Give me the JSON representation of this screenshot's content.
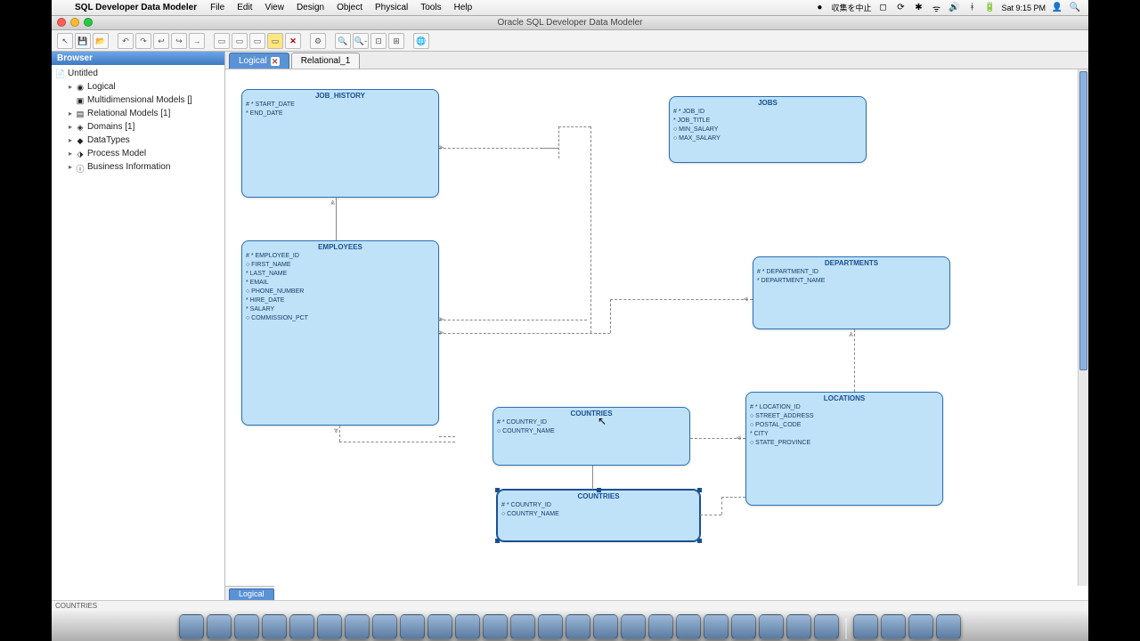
{
  "menubar": {
    "app_name": "SQL Developer Data Modeler",
    "menus": [
      "File",
      "Edit",
      "View",
      "Design",
      "Object",
      "Physical",
      "Tools",
      "Help"
    ],
    "status_text": "収集を中止",
    "clock": "Sat 9:15 PM"
  },
  "window": {
    "title": "Oracle SQL Developer Data Modeler"
  },
  "browser": {
    "header": "Browser",
    "root": "Untitled",
    "items": [
      {
        "label": "Logical",
        "depth": 1,
        "disclose": "▸"
      },
      {
        "label": "Multidimensional Models []",
        "depth": 1,
        "disclose": ""
      },
      {
        "label": "Relational Models [1]",
        "depth": 1,
        "disclose": "▸"
      },
      {
        "label": "Domains [1]",
        "depth": 1,
        "disclose": "▸"
      },
      {
        "label": "DataTypes",
        "depth": 1,
        "disclose": "▸"
      },
      {
        "label": "Process Model",
        "depth": 1,
        "disclose": "▸"
      },
      {
        "label": "Business Information",
        "depth": 1,
        "disclose": "▸"
      }
    ]
  },
  "tabs": {
    "top": [
      {
        "label": "Logical",
        "active": true,
        "closable": true
      },
      {
        "label": "Relational_1",
        "active": false,
        "closable": false
      }
    ],
    "bottom": "Logical"
  },
  "entities": {
    "job_history": {
      "title": "JOB_HISTORY",
      "attrs": [
        "# * START_DATE",
        "* END_DATE"
      ]
    },
    "jobs": {
      "title": "JOBS",
      "attrs": [
        "# * JOB_ID",
        "* JOB_TITLE",
        "○ MIN_SALARY",
        "○ MAX_SALARY"
      ]
    },
    "employees": {
      "title": "EMPLOYEES",
      "attrs": [
        "# * EMPLOYEE_ID",
        "○ FIRST_NAME",
        "* LAST_NAME",
        "* EMAIL",
        "○ PHONE_NUMBER",
        "* HIRE_DATE",
        "* SALARY",
        "○ COMMISSION_PCT"
      ]
    },
    "departments": {
      "title": "DEPARTMENTS",
      "attrs": [
        "# * DEPARTMENT_ID",
        "* DEPARTMENT_NAME"
      ]
    },
    "countries_a": {
      "title": "COUNTRIES",
      "attrs": [
        "# * COUNTRY_ID",
        "○ COUNTRY_NAME"
      ]
    },
    "countries_b": {
      "title": "COUNTRIES",
      "attrs": [
        "# * COUNTRY_ID",
        "○ COUNTRY_NAME"
      ]
    },
    "locations": {
      "title": "LOCATIONS",
      "attrs": [
        "# * LOCATION_ID",
        "○ STREET_ADDRESS",
        "○ POSTAL_CODE",
        "* CITY",
        "○ STATE_PROVINCE"
      ]
    }
  },
  "status": "COUNTRIES"
}
